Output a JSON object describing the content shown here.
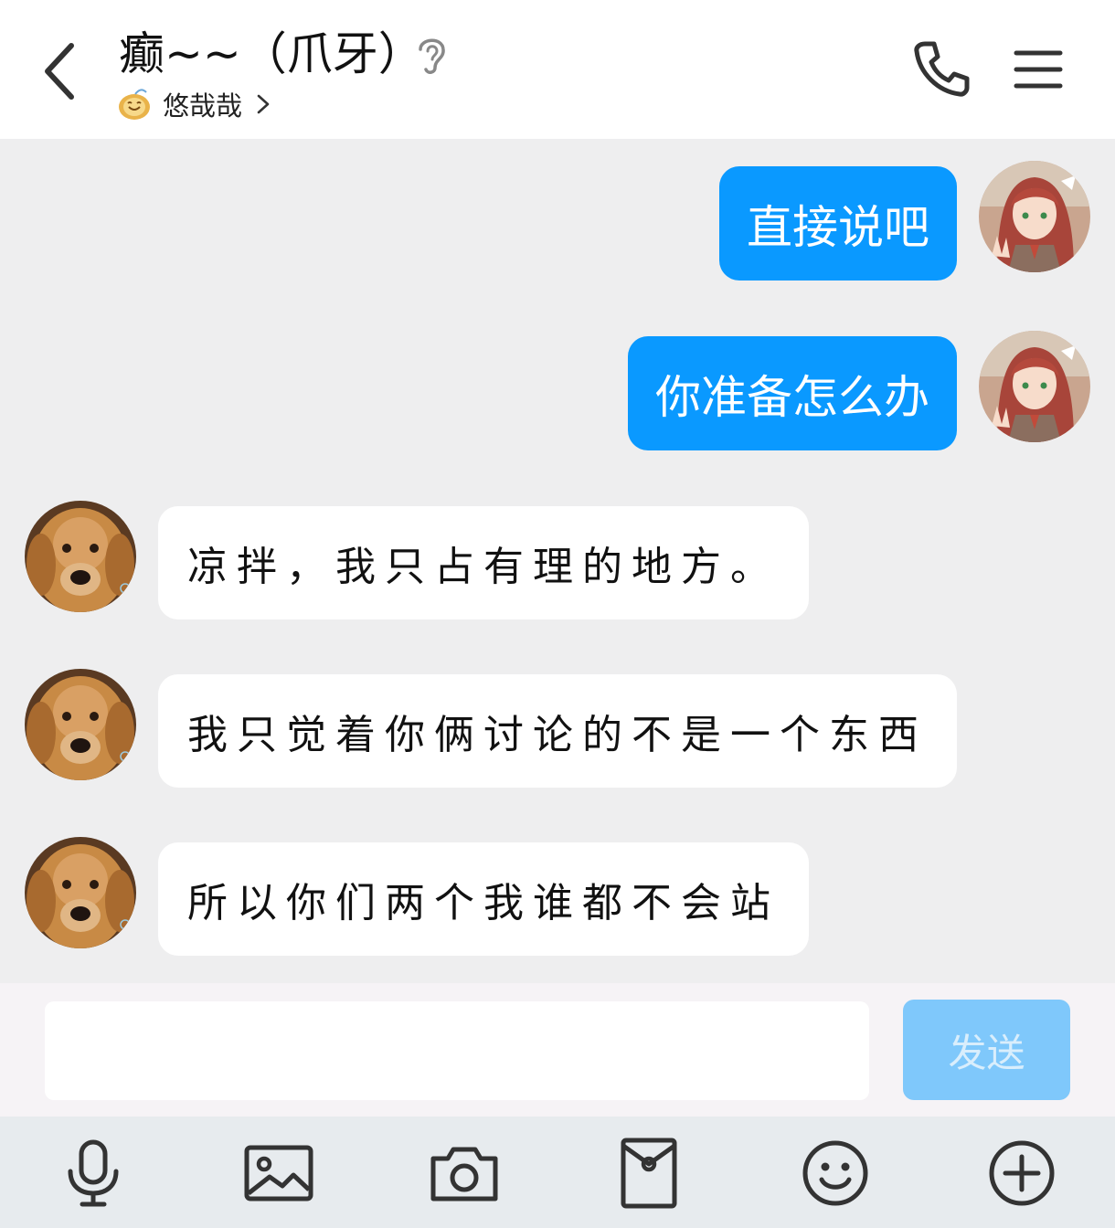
{
  "header": {
    "title": "癫~~（爪牙）",
    "status_text": "悠哉哉"
  },
  "messages": [
    {
      "direction": "outgoing",
      "text": "直接说吧"
    },
    {
      "direction": "outgoing",
      "text": "你准备怎么办"
    },
    {
      "direction": "incoming",
      "text": "凉拌，我只占有理的地方。"
    },
    {
      "direction": "incoming",
      "text": "我只觉着你俩讨论的不是一个东西"
    },
    {
      "direction": "incoming",
      "text": "所以你们两个我谁都不会站"
    }
  ],
  "input": {
    "value": "",
    "send_label": "发送"
  },
  "toolbar": {
    "icons": [
      "microphone-icon",
      "image-icon",
      "camera-icon",
      "red-packet-icon",
      "emoji-icon",
      "plus-icon"
    ]
  },
  "colors": {
    "outgoing_bubble": "#0a99ff",
    "incoming_bubble": "#ffffff",
    "chat_background": "#eeeeef",
    "send_button_disabled": "#7fc8fb"
  }
}
